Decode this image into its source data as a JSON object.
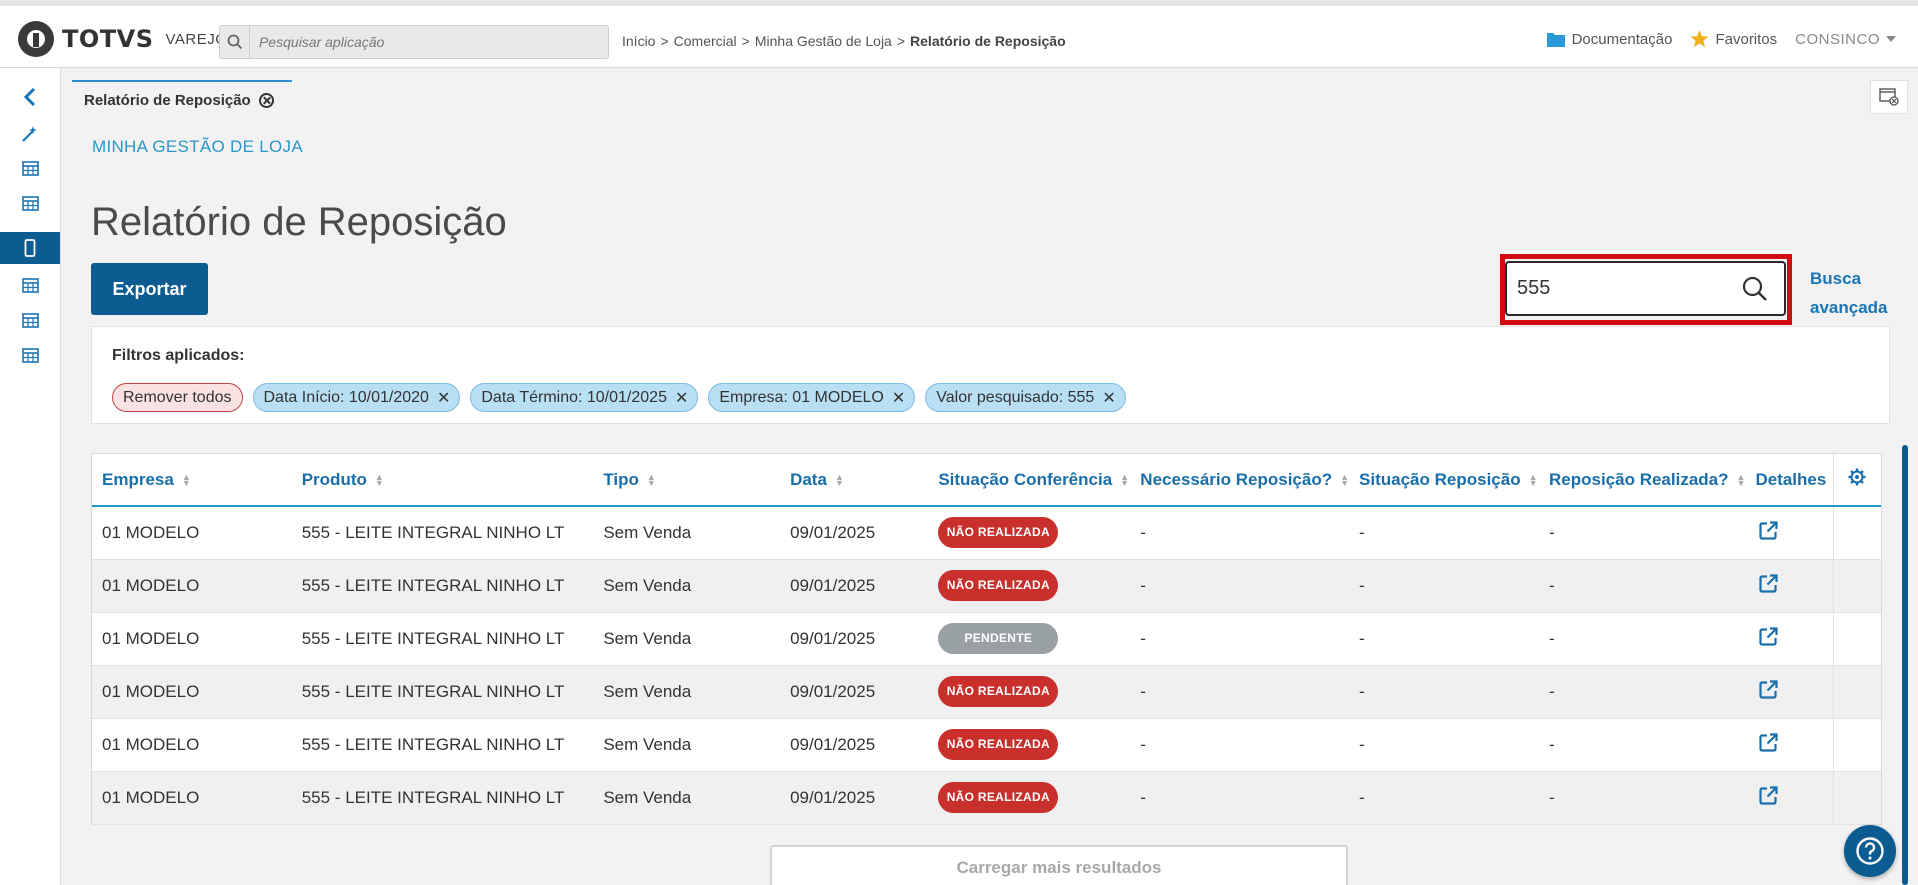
{
  "header": {
    "logo_text": "TOTVS",
    "logo_sub": "VAREJO",
    "search_placeholder": "Pesquisar aplicação",
    "breadcrumb": [
      "Início",
      "Comercial",
      "Minha Gestão de Loja",
      "Relatório de Reposição"
    ],
    "breadcrumb_sep": ">",
    "documentation": "Documentação",
    "favorites": "Favoritos",
    "user": "CONSINCO"
  },
  "sidebar": {
    "items": [
      {
        "icon": "chevron-left-icon"
      },
      {
        "icon": "wand-icon"
      },
      {
        "icon": "table-icon"
      },
      {
        "icon": "table-icon"
      },
      {
        "icon": "mobile-icon",
        "active": true
      },
      {
        "icon": "table-icon"
      },
      {
        "icon": "table-icon"
      },
      {
        "icon": "table-icon"
      }
    ]
  },
  "tab": {
    "label": "Relatório de Reposição"
  },
  "page": {
    "section": "MINHA GESTÃO DE LOJA",
    "title": "Relatório de Reposição",
    "export_label": "Exportar",
    "search_value": "555",
    "advanced_search": "Busca avançada"
  },
  "filters": {
    "label": "Filtros aplicados:",
    "remove_all": "Remover todos",
    "chips": [
      "Data Início: 10/01/2020",
      "Data Término: 10/01/2025",
      "Empresa: 01 MODELO",
      "Valor pesquisado: 555"
    ]
  },
  "table": {
    "columns": [
      "Empresa",
      "Produto",
      "Tipo",
      "Data",
      "Situação Conferência",
      "Necessário Reposição?",
      "Situação Reposição",
      "Reposição Realizada?",
      "Detalhes"
    ],
    "rows": [
      {
        "empresa": "01 MODELO",
        "produto": "555 - LEITE INTEGRAL NINHO LT",
        "tipo": "Sem Venda",
        "data": "09/01/2025",
        "situacao": "NÃO REALIZADA",
        "status": "red",
        "necessario": "-",
        "sit_reposicao": "-",
        "realizada": "-"
      },
      {
        "empresa": "01 MODELO",
        "produto": "555 - LEITE INTEGRAL NINHO LT",
        "tipo": "Sem Venda",
        "data": "09/01/2025",
        "situacao": "NÃO REALIZADA",
        "status": "red",
        "necessario": "-",
        "sit_reposicao": "-",
        "realizada": "-"
      },
      {
        "empresa": "01 MODELO",
        "produto": "555 - LEITE INTEGRAL NINHO LT",
        "tipo": "Sem Venda",
        "data": "09/01/2025",
        "situacao": "PENDENTE",
        "status": "gray",
        "necessario": "-",
        "sit_reposicao": "-",
        "realizada": "-"
      },
      {
        "empresa": "01 MODELO",
        "produto": "555 - LEITE INTEGRAL NINHO LT",
        "tipo": "Sem Venda",
        "data": "09/01/2025",
        "situacao": "NÃO REALIZADA",
        "status": "red",
        "necessario": "-",
        "sit_reposicao": "-",
        "realizada": "-"
      },
      {
        "empresa": "01 MODELO",
        "produto": "555 - LEITE INTEGRAL NINHO LT",
        "tipo": "Sem Venda",
        "data": "09/01/2025",
        "situacao": "NÃO REALIZADA",
        "status": "red",
        "necessario": "-",
        "sit_reposicao": "-",
        "realizada": "-"
      },
      {
        "empresa": "01 MODELO",
        "produto": "555 - LEITE INTEGRAL NINHO LT",
        "tipo": "Sem Venda",
        "data": "09/01/2025",
        "situacao": "NÃO REALIZADA",
        "status": "red",
        "necessario": "-",
        "sit_reposicao": "-",
        "realizada": "-"
      }
    ],
    "load_more": "Carregar mais resultados"
  },
  "colors": {
    "primary": "#0c5b91",
    "accent": "#2a97c9",
    "danger": "#c9302c",
    "highlight": "#d20b10"
  }
}
